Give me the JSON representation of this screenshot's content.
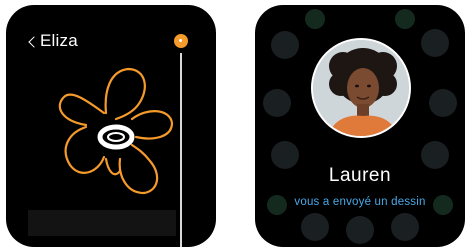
{
  "left_watch": {
    "back_label": "Eliza",
    "selected_color": "#f59b2b"
  },
  "right_watch": {
    "sender_name": "Lauren",
    "message": "vous a envoyé un dessin"
  },
  "colors": {
    "accent": "#f59b2b",
    "link_blue": "#4aa8e8",
    "watch_bg": "#000000"
  },
  "icons": [
    "chevron-left-icon",
    "color-dot-icon"
  ]
}
